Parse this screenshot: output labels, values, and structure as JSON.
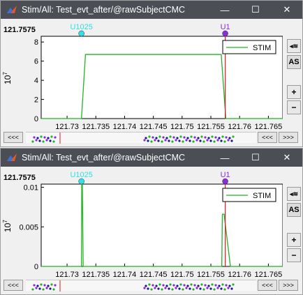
{
  "windows": [
    {
      "title": "Stim/All: Test_evt_after/@rawSubjectCMC",
      "time_label": "121.7575",
      "events": [
        {
          "label": "U1025",
          "x": 121.7325,
          "color": "#2ee0e8"
        },
        {
          "label": "U1",
          "x": 121.7575,
          "color": "#8a2be2"
        }
      ],
      "y_ticks": [
        "0",
        "2",
        "4",
        "6",
        "8"
      ],
      "y_unit": "10",
      "y_unit_exp": "7",
      "legend_label": "STIM",
      "chart_data": {
        "type": "line",
        "series": [
          {
            "name": "STIM",
            "x": [
              121.7255,
              121.7325,
              121.7332,
              121.7568,
              121.7576,
              121.7675
            ],
            "y": [
              0,
              0,
              6.7,
              6.7,
              0,
              0
            ]
          }
        ],
        "ylim": [
          0,
          8.6
        ],
        "xlim": [
          121.7255,
          121.7675
        ]
      }
    },
    {
      "title": "Stim/All: Test_evt_after/@rawSubjectCMC",
      "time_label": "121.7575",
      "events": [
        {
          "label": "U1025",
          "x": 121.7325,
          "color": "#2ee0e8"
        },
        {
          "label": "U1",
          "x": 121.7575,
          "color": "#8a2be2"
        }
      ],
      "y_ticks": [
        "0",
        "0.005",
        "0.01"
      ],
      "y_unit": "10",
      "y_unit_exp": "7",
      "legend_label": "STIM",
      "chart_data": {
        "type": "line",
        "series": [
          {
            "name": "STIM",
            "x": [
              121.7255,
              121.7325,
              121.73255,
              121.73265,
              121.7328,
              121.7569,
              121.757,
              121.7573,
              121.7584,
              121.7675
            ],
            "y": [
              0,
              0,
              0.0104,
              0.0104,
              0,
              0,
              0.0066,
              0.0066,
              0,
              0
            ]
          }
        ],
        "ylim": [
          0,
          0.0104
        ],
        "xlim": [
          121.7255,
          121.7675
        ]
      }
    }
  ],
  "x_ticks": [
    "121.73",
    "121.735",
    "121.74",
    "121.745",
    "121.75",
    "121.755",
    "121.76",
    "121.765"
  ],
  "x_tick_values": [
    121.73,
    121.735,
    121.74,
    121.745,
    121.75,
    121.755,
    121.76,
    121.765
  ],
  "buttons": {
    "zoom_toggle": "◂≋",
    "autoscale": "AS",
    "zoom_in": "+",
    "zoom_out": "−",
    "prev_far": "<<<",
    "prev": "<<<",
    "next": ">>>"
  },
  "window_buttons": {
    "minimize": "—",
    "maximize": "☐",
    "close": "✕"
  },
  "colors": {
    "titlebar": "#4b4e54",
    "signal": "#22b422",
    "cursor": "#cc2222"
  }
}
